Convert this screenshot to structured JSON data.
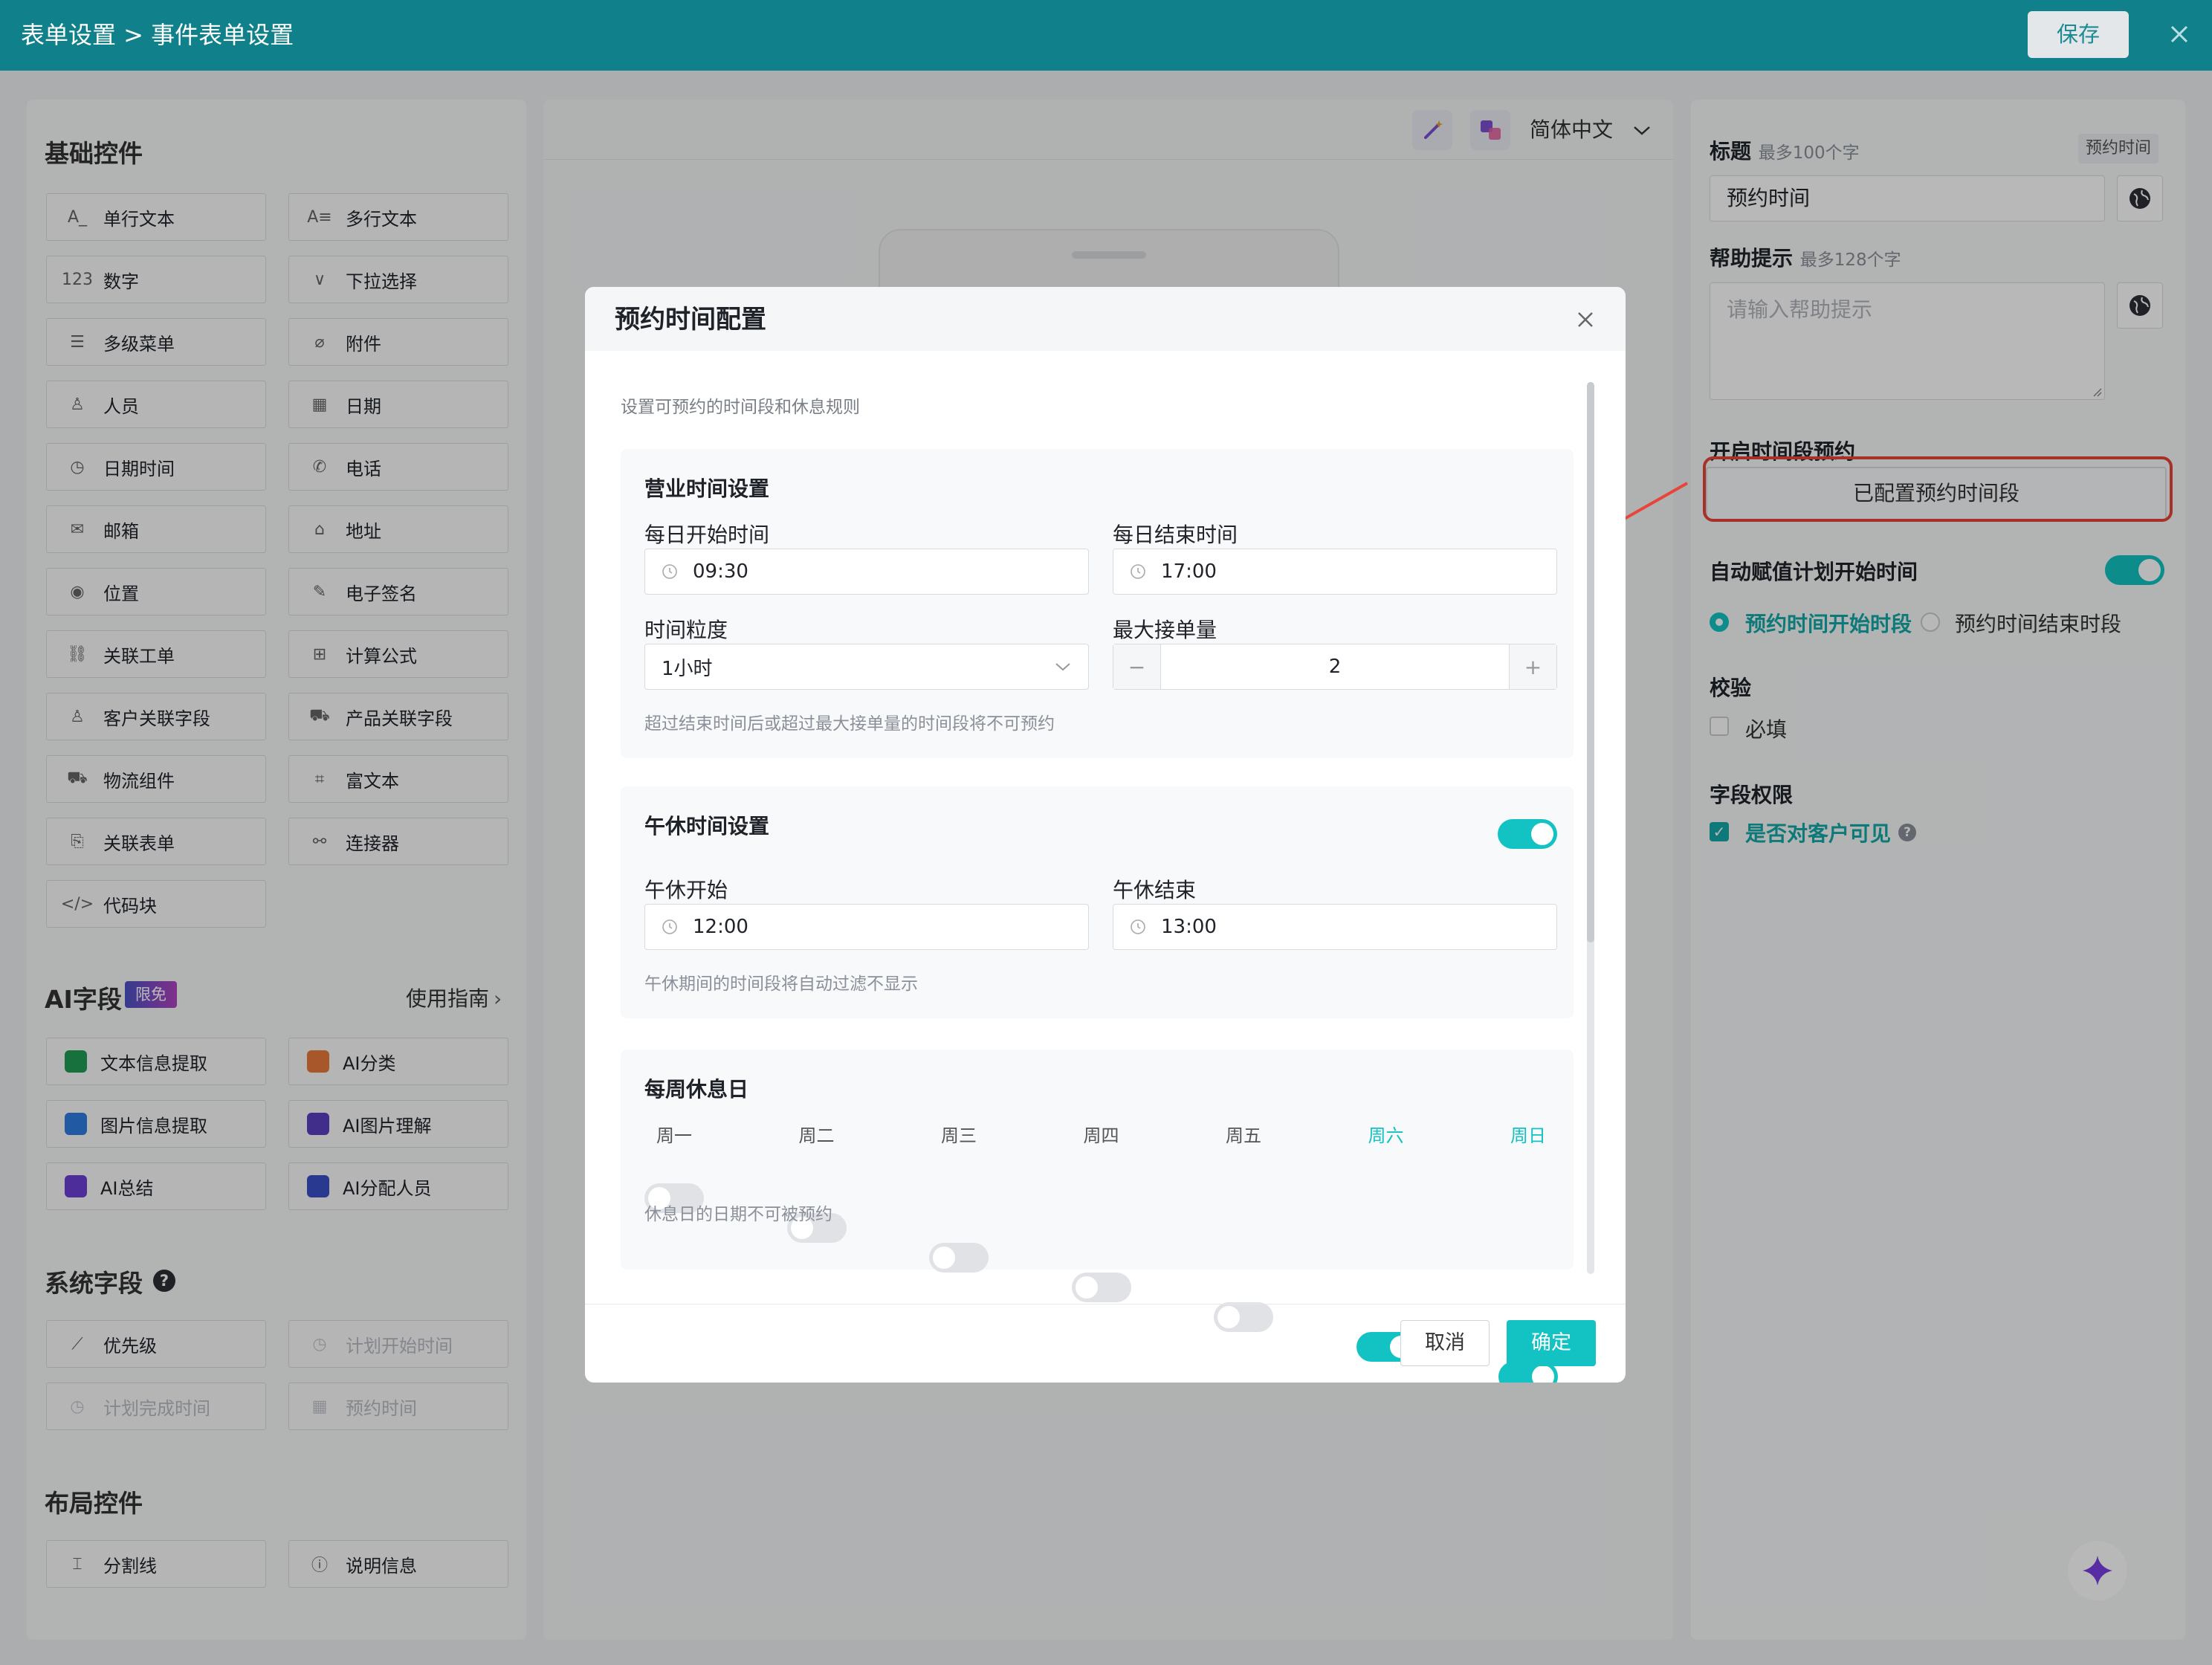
{
  "header": {
    "breadcrumb": "表单设置 > 事件表单设置",
    "save_label": "保存"
  },
  "left": {
    "basic_title": "基础控件",
    "basic_controls": [
      {
        "label": "单行文本",
        "icon": "single-line-text-icon",
        "glyph": "A_"
      },
      {
        "label": "多行文本",
        "icon": "multi-line-text-icon",
        "glyph": "A≡"
      },
      {
        "label": "数字",
        "icon": "number-icon",
        "glyph": "123"
      },
      {
        "label": "下拉选择",
        "icon": "chevron-down-icon",
        "glyph": "∨"
      },
      {
        "label": "多级菜单",
        "icon": "list-icon",
        "glyph": "☰"
      },
      {
        "label": "附件",
        "icon": "paperclip-icon",
        "glyph": "⌀"
      },
      {
        "label": "人员",
        "icon": "person-icon",
        "glyph": "♙"
      },
      {
        "label": "日期",
        "icon": "calendar-icon",
        "glyph": "▦"
      },
      {
        "label": "日期时间",
        "icon": "clock-icon",
        "glyph": "◷"
      },
      {
        "label": "电话",
        "icon": "phone-icon",
        "glyph": "✆"
      },
      {
        "label": "邮箱",
        "icon": "mail-icon",
        "glyph": "✉"
      },
      {
        "label": "地址",
        "icon": "map-icon",
        "glyph": "⌂"
      },
      {
        "label": "位置",
        "icon": "location-pin-icon",
        "glyph": "◉"
      },
      {
        "label": "电子签名",
        "icon": "signature-pen-icon",
        "glyph": "✎"
      },
      {
        "label": "关联工单",
        "icon": "link-icon",
        "glyph": "⛓"
      },
      {
        "label": "计算公式",
        "icon": "calculator-icon",
        "glyph": "⊞"
      },
      {
        "label": "客户关联字段",
        "icon": "customer-icon",
        "glyph": "♙"
      },
      {
        "label": "产品关联字段",
        "icon": "product-icon",
        "glyph": "⛟"
      },
      {
        "label": "物流组件",
        "icon": "truck-icon",
        "glyph": "⛟"
      },
      {
        "label": "富文本",
        "icon": "rich-text-icon",
        "glyph": "⌗"
      },
      {
        "label": "关联表单",
        "icon": "linked-form-icon",
        "glyph": "⎘"
      },
      {
        "label": "连接器",
        "icon": "connector-icon",
        "glyph": "⚯"
      },
      {
        "label": "代码块",
        "icon": "code-icon",
        "glyph": "</>"
      }
    ],
    "ai_title": "AI字段",
    "ai_badge": "限免",
    "ai_guide": "使用指南",
    "ai_controls": [
      {
        "label": "文本信息提取",
        "icon": "text-extract-icon",
        "color": "#1f9d55"
      },
      {
        "label": "AI分类",
        "icon": "ai-classify-icon",
        "color": "#e8793a"
      },
      {
        "label": "图片信息提取",
        "icon": "image-extract-icon",
        "color": "#2f7de1"
      },
      {
        "label": "AI图片理解",
        "icon": "ai-image-icon",
        "color": "#5a3fc0"
      },
      {
        "label": "AI总结",
        "icon": "ai-summary-icon",
        "color": "#6b3fd4"
      },
      {
        "label": "AI分配人员",
        "icon": "ai-assign-icon",
        "color": "#3a4fc8"
      }
    ],
    "system_title": "系统字段",
    "system_controls": [
      {
        "label": "优先级",
        "icon": "trend-icon",
        "glyph": "⟋",
        "disabled": false
      },
      {
        "label": "计划开始时间",
        "icon": "clock-icon",
        "glyph": "◷",
        "disabled": true
      },
      {
        "label": "计划完成时间",
        "icon": "clock-icon",
        "glyph": "◷",
        "disabled": true
      },
      {
        "label": "预约时间",
        "icon": "calendar-clock-icon",
        "glyph": "▦",
        "disabled": true
      }
    ],
    "layout_title": "布局控件",
    "layout_controls": [
      {
        "label": "分割线",
        "icon": "divider-icon",
        "glyph": "⌶"
      },
      {
        "label": "说明信息",
        "icon": "info-icon",
        "glyph": "ⓘ"
      }
    ]
  },
  "toolbar": {
    "language": "简体中文"
  },
  "right": {
    "title_label": "标题",
    "title_limit": "最多100个字",
    "title_tag": "预约时间",
    "title_value": "预约时间",
    "help_label": "帮助提示",
    "help_limit": "最多128个字",
    "help_placeholder": "请输入帮助提示",
    "slot_label": "开启时间段预约",
    "slot_button": "已配置预约时间段",
    "auto_label": "自动赋值计划开始时间",
    "auto_on": true,
    "radio_start": "预约时间开始时段",
    "radio_end": "预约时间结束时段",
    "validate_label": "校验",
    "required_label": "必填",
    "perm_label": "字段权限",
    "visible_label": "是否对客户可见"
  },
  "modal": {
    "title": "预约时间配置",
    "desc": "设置可预约的时间段和休息规则",
    "business": {
      "title": "营业时间设置",
      "start_label": "每日开始时间",
      "start_value": "09:30",
      "end_label": "每日结束时间",
      "end_value": "17:00",
      "gran_label": "时间粒度",
      "gran_value": "1小时",
      "max_label": "最大接单量",
      "max_value": "2",
      "hint": "超过结束时间后或超过最大接单量的时间段将不可预约"
    },
    "lunch": {
      "title": "午休时间设置",
      "enabled": true,
      "start_label": "午休开始",
      "start_value": "12:00",
      "end_label": "午休结束",
      "end_value": "13:00",
      "hint": "午休期间的时间段将自动过滤不显示"
    },
    "weekly": {
      "title": "每周休息日",
      "days": [
        {
          "label": "周一",
          "on": false
        },
        {
          "label": "周二",
          "on": false
        },
        {
          "label": "周三",
          "on": false
        },
        {
          "label": "周四",
          "on": false
        },
        {
          "label": "周五",
          "on": false
        },
        {
          "label": "周六",
          "on": true
        },
        {
          "label": "周日",
          "on": true
        }
      ],
      "hint": "休息日的日期不可被预约"
    },
    "cancel": "取消",
    "ok": "确定"
  },
  "colors": {
    "brand": "#10808a",
    "accent": "#13c2c2",
    "highlight": "#e8443a"
  }
}
